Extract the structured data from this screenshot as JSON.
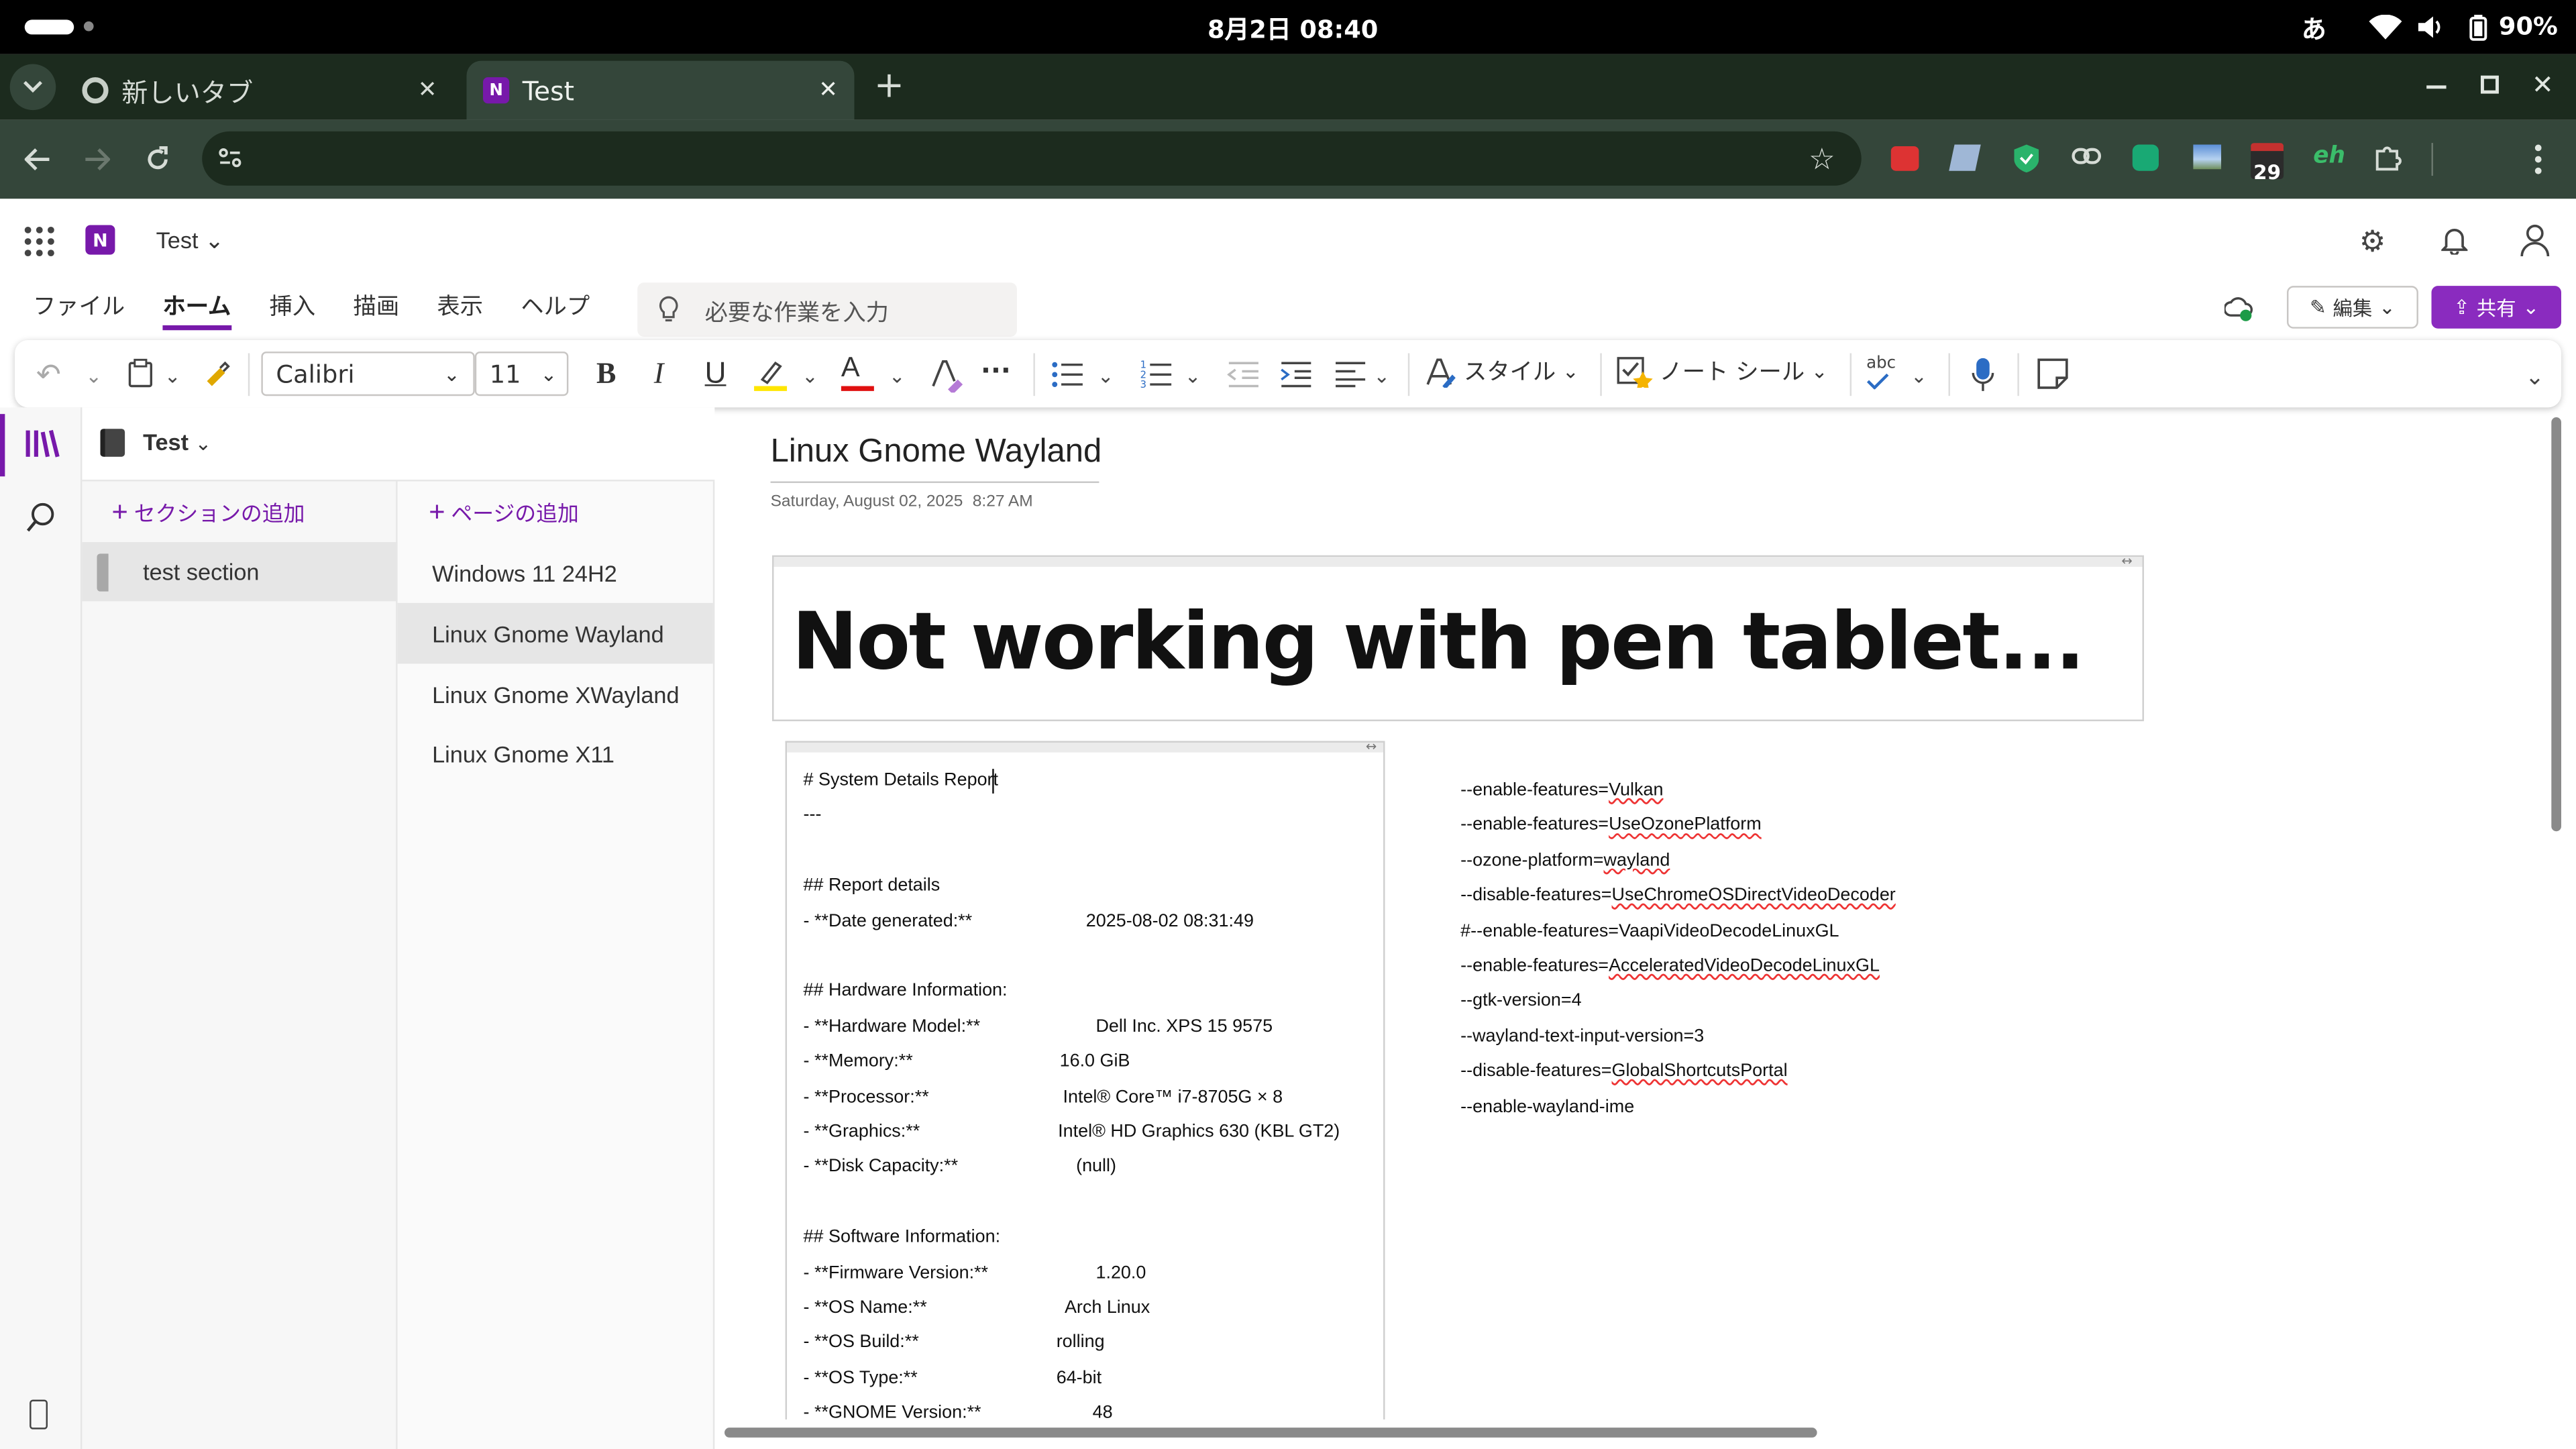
{
  "status_bar": {
    "datetime": "8月2日 08:40",
    "ime": "あ",
    "battery": "90%"
  },
  "browser": {
    "tabs": [
      {
        "title": "新しいタブ",
        "icon": "chrome-icon"
      },
      {
        "title": "Test",
        "icon": "onenote-icon"
      }
    ],
    "new_tab": "+",
    "calendar_badge": "29",
    "eh_extension": "eh"
  },
  "app": {
    "notebook_title": "Test",
    "menu": [
      "ファイル",
      "ホーム",
      "挿入",
      "描画",
      "表示",
      "ヘルプ"
    ],
    "active_menu": "ホーム",
    "search_placeholder": "必要な作業を入力",
    "edit_button": "編集",
    "share_button": "共有"
  },
  "ribbon": {
    "font": "Calibri",
    "size": "11",
    "bold": "B",
    "italic": "I",
    "underline": "U",
    "font_color": "A",
    "more": "···",
    "styles": "スタイル",
    "tags": "ノート シール",
    "spelling": "abc"
  },
  "sidebar": {
    "notebook": "Test",
    "add_section": "セクションの追加",
    "add_page": "ページの追加",
    "sections": [
      "test section"
    ],
    "pages": [
      "Windows 11 24H2",
      "Linux Gnome Wayland",
      "Linux Gnome XWayland",
      "Linux Gnome X11"
    ]
  },
  "page": {
    "title": "Linux Gnome Wayland",
    "date": "Saturday, August 02, 2025",
    "time": "8:27 AM",
    "headline": "Not working with pen tablet...",
    "report": [
      {
        "label": "# System Details Report",
        "value": ""
      },
      {
        "label": "---",
        "value": ""
      },
      {
        "label": "",
        "value": ""
      },
      {
        "label": "## Report details",
        "value": ""
      },
      {
        "label": "- **Date generated:**",
        "value": "2025-08-02 08:31:49"
      },
      {
        "label": "",
        "value": ""
      },
      {
        "label": "## Hardware Information:",
        "value": ""
      },
      {
        "label": "- **Hardware Model:**",
        "value": "Dell Inc. XPS 15 9575"
      },
      {
        "label": "- **Memory:**",
        "value": "16.0 GiB"
      },
      {
        "label": "- **Processor:**",
        "value": "Intel® Core™ i7-8705G × 8"
      },
      {
        "label": "- **Graphics:**",
        "value": "Intel® HD Graphics 630 (KBL GT2)"
      },
      {
        "label": "- **Disk Capacity:**",
        "value": "(null)"
      },
      {
        "label": "",
        "value": ""
      },
      {
        "label": "## Software Information:",
        "value": ""
      },
      {
        "label": "- **Firmware Version:**",
        "value": "1.20.0"
      },
      {
        "label": "- **OS Name:**",
        "value": "Arch Linux"
      },
      {
        "label": "- **OS Build:**",
        "value": "rolling"
      },
      {
        "label": "- **OS Type:**",
        "value": "64-bit"
      },
      {
        "label": "- **GNOME Version:**",
        "value": "48"
      }
    ],
    "flags": [
      {
        "prefix": "--enable-features=",
        "value": "Vulkan"
      },
      {
        "prefix": "--enable-features=",
        "value": "UseOzonePlatform"
      },
      {
        "prefix": "--ozone-platform=",
        "value": "wayland"
      },
      {
        "prefix": "--disable-features=",
        "value": "UseChromeOSDirectVideoDecoder"
      },
      {
        "prefix": "#--enable-features=VaapiVideoDecodeLinuxGL",
        "value": ""
      },
      {
        "prefix": "--enable-features=",
        "value": "AcceleratedVideoDecodeLinuxGL"
      },
      {
        "prefix": "--gtk-version=4",
        "value": ""
      },
      {
        "prefix": "--wayland-text-input-version=3",
        "value": ""
      },
      {
        "prefix": "--disable-features=",
        "value": "GlobalShortcutsPortal"
      },
      {
        "prefix": "--enable-wayland-ime",
        "value": ""
      }
    ]
  },
  "colors": {
    "onenote_purple": "#7719aa",
    "share_bg": "#8a2bbf",
    "browser_dark": "#1c2b1e",
    "browser_mid": "#34463a"
  }
}
